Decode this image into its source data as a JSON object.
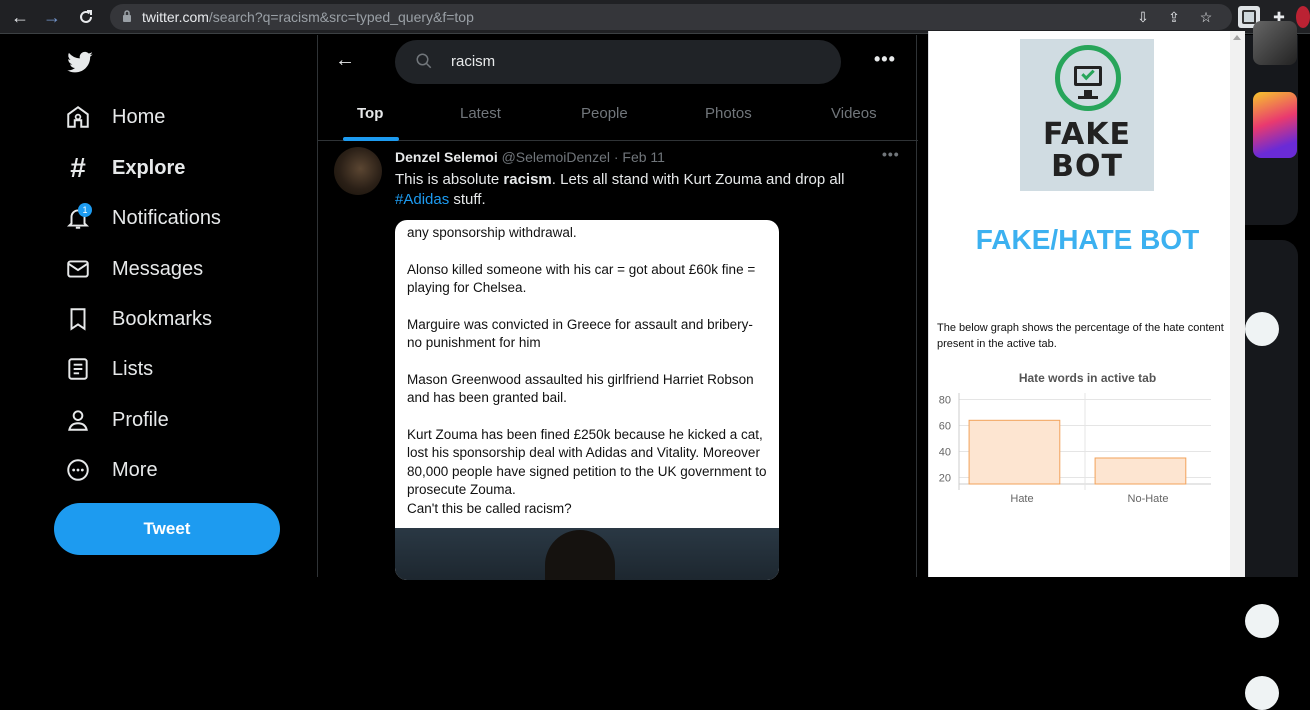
{
  "browser": {
    "url_host": "twitter.com",
    "url_path": "/search?q=racism&src=typed_query&f=top"
  },
  "sidebar": {
    "items": [
      {
        "label": "Home",
        "icon": "home-icon"
      },
      {
        "label": "Explore",
        "icon": "hashtag-icon"
      },
      {
        "label": "Notifications",
        "icon": "bell-icon",
        "badge": "1"
      },
      {
        "label": "Messages",
        "icon": "envelope-icon"
      },
      {
        "label": "Bookmarks",
        "icon": "bookmark-icon"
      },
      {
        "label": "Lists",
        "icon": "list-icon"
      },
      {
        "label": "Profile",
        "icon": "person-icon"
      },
      {
        "label": "More",
        "icon": "more-circle-icon"
      }
    ],
    "tweet_button": "Tweet"
  },
  "search": {
    "query": "racism"
  },
  "tabs": [
    "Top",
    "Latest",
    "People",
    "Photos",
    "Videos"
  ],
  "tweet": {
    "name": "Denzel Selemoi",
    "handle": "@SelemoiDenzel",
    "date": "· Feb 11",
    "text_before": "This is absolute ",
    "text_bold": "racism",
    "text_after": ". Lets all stand with Kurt Zouma and drop all ",
    "hashtag": "#Adidas",
    "text_end": " stuff.",
    "media_paragraphs": [
      "any sponsorship withdrawal.",
      "Alonso killed someone with his car = got about £60k fine = playing for Chelsea.",
      "Marguire was convicted in Greece for assault and bribery- no punishment for him",
      "Mason Greenwood assaulted his girlfriend Harriet Robson and has been granted bail.",
      "Kurt Zouma has been fined £250k because he kicked a cat, lost his sponsorship deal with Adidas and Vitality. Moreover 80,000 people have signed petition to the UK government to prosecute Zouma.",
      "Can't this be called racism?"
    ]
  },
  "extension": {
    "logo_word1": "FAKE",
    "logo_word2": "BOT",
    "title": "FAKE/HATE BOT",
    "description": "The below graph shows the percentage of the hate content present in the active tab."
  },
  "chart_data": {
    "type": "bar",
    "title": "Hate words in active tab",
    "categories": [
      "Hate",
      "No-Hate"
    ],
    "values": [
      64,
      35
    ],
    "ylim": [
      15,
      85
    ],
    "yticks": [
      "80",
      "60",
      "40",
      "20"
    ],
    "ytick_values": [
      80,
      60,
      40,
      20
    ],
    "grid": true,
    "bar_fill": "#fde5d1",
    "bar_stroke": "#f2a25a"
  },
  "colors": {
    "accent": "#1d9bf0",
    "popup_title": "#3cb1f0"
  }
}
